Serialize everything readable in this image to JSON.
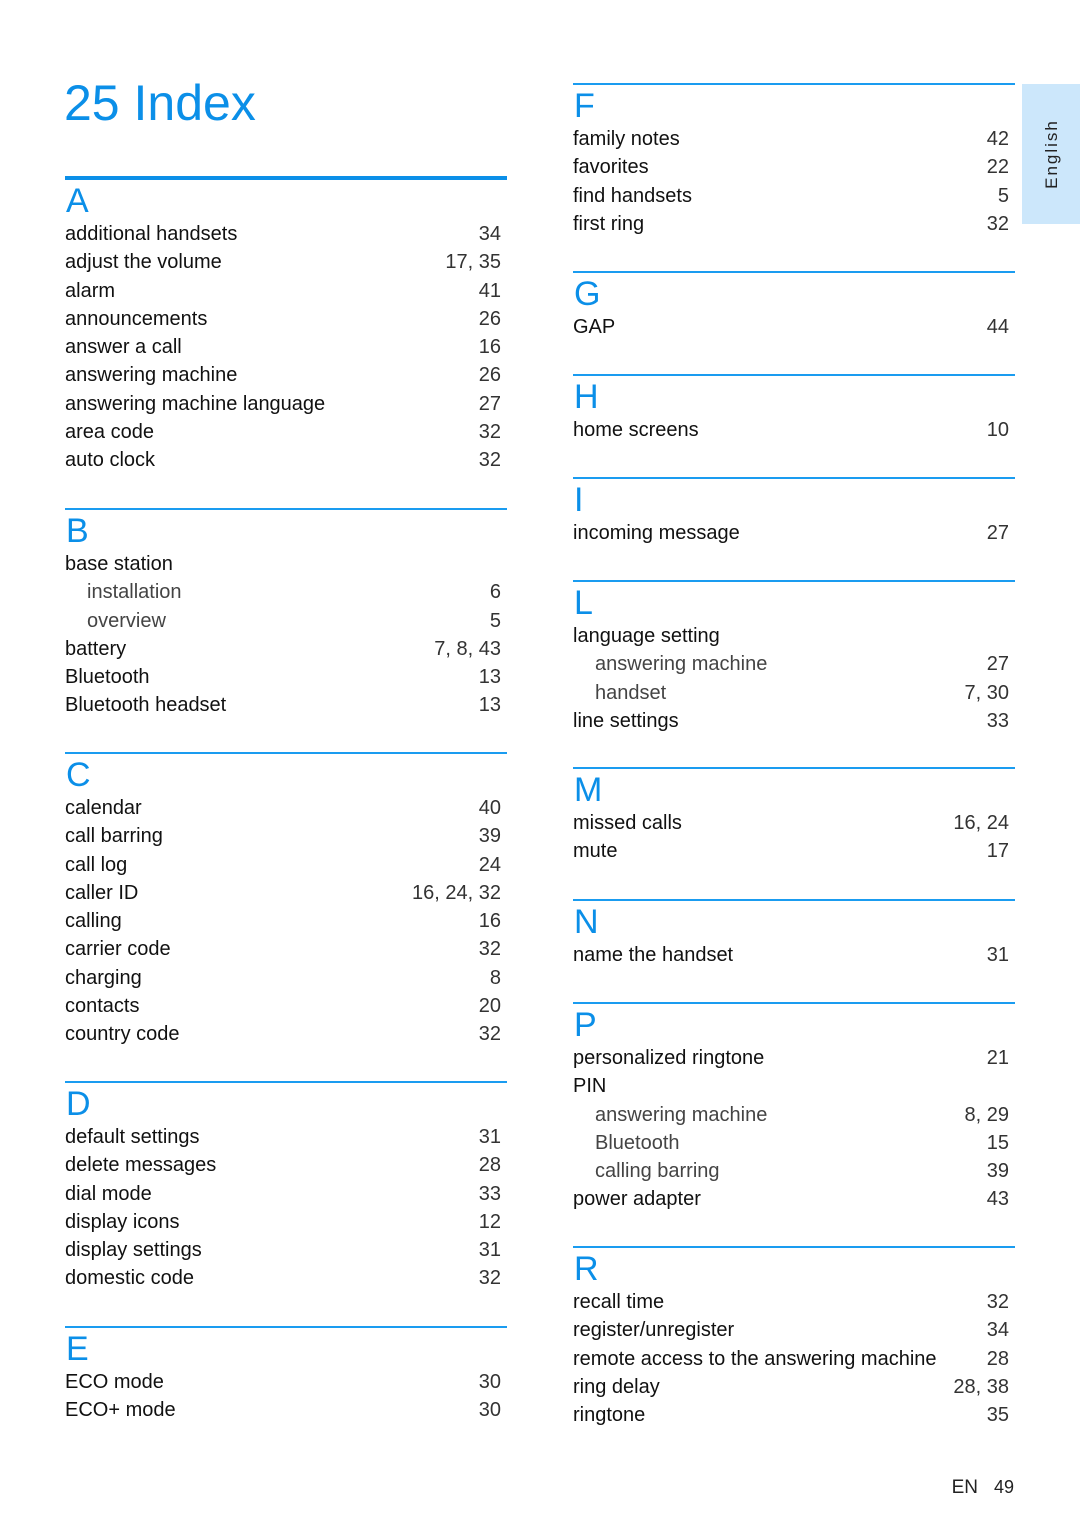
{
  "title": "25 Index",
  "language_tab": "English",
  "footer": {
    "lang": "EN",
    "page": "49"
  },
  "left": [
    {
      "letter": "A",
      "entries": [
        {
          "term": "additional handsets",
          "pages": "34"
        },
        {
          "term": "adjust the volume",
          "pages": "17, 35"
        },
        {
          "term": "alarm",
          "pages": "41"
        },
        {
          "term": "announcements",
          "pages": "26"
        },
        {
          "term": "answer a call",
          "pages": "16"
        },
        {
          "term": "answering machine",
          "pages": "26"
        },
        {
          "term": "answering machine language",
          "pages": "27"
        },
        {
          "term": "area code",
          "pages": "32"
        },
        {
          "term": "auto clock",
          "pages": "32"
        }
      ]
    },
    {
      "letter": "B",
      "entries": [
        {
          "term": "base station",
          "pages": ""
        },
        {
          "term": "installation",
          "pages": "6",
          "sub": true
        },
        {
          "term": "overview",
          "pages": "5",
          "sub": true
        },
        {
          "term": "battery",
          "pages": "7, 8, 43"
        },
        {
          "term": "Bluetooth",
          "pages": "13"
        },
        {
          "term": "Bluetooth headset",
          "pages": "13"
        }
      ]
    },
    {
      "letter": "C",
      "entries": [
        {
          "term": "calendar",
          "pages": "40"
        },
        {
          "term": "call barring",
          "pages": "39"
        },
        {
          "term": "call log",
          "pages": "24"
        },
        {
          "term": "caller ID",
          "pages": "16, 24, 32"
        },
        {
          "term": "calling",
          "pages": "16"
        },
        {
          "term": "carrier code",
          "pages": "32"
        },
        {
          "term": "charging",
          "pages": "8"
        },
        {
          "term": "contacts",
          "pages": "20"
        },
        {
          "term": "country code",
          "pages": "32"
        }
      ]
    },
    {
      "letter": "D",
      "entries": [
        {
          "term": "default settings",
          "pages": "31"
        },
        {
          "term": "delete messages",
          "pages": "28"
        },
        {
          "term": "dial mode",
          "pages": "33"
        },
        {
          "term": "display icons",
          "pages": "12"
        },
        {
          "term": "display settings",
          "pages": "31"
        },
        {
          "term": "domestic code",
          "pages": "32"
        }
      ]
    },
    {
      "letter": "E",
      "entries": [
        {
          "term": "ECO mode",
          "pages": "30"
        },
        {
          "term": "ECO+ mode",
          "pages": "30"
        }
      ]
    }
  ],
  "right": [
    {
      "letter": "F",
      "entries": [
        {
          "term": "family notes",
          "pages": "42"
        },
        {
          "term": "favorites",
          "pages": "22"
        },
        {
          "term": "find handsets",
          "pages": "5"
        },
        {
          "term": "first ring",
          "pages": "32"
        }
      ]
    },
    {
      "letter": "G",
      "entries": [
        {
          "term": "GAP",
          "pages": "44"
        }
      ]
    },
    {
      "letter": "H",
      "entries": [
        {
          "term": "home screens",
          "pages": "10"
        }
      ]
    },
    {
      "letter": "I",
      "entries": [
        {
          "term": "incoming message",
          "pages": "27"
        }
      ]
    },
    {
      "letter": "L",
      "entries": [
        {
          "term": "language setting",
          "pages": ""
        },
        {
          "term": "answering machine",
          "pages": "27",
          "sub": true
        },
        {
          "term": "handset",
          "pages": "7, 30",
          "sub": true
        },
        {
          "term": "line settings",
          "pages": "33"
        }
      ]
    },
    {
      "letter": "M",
      "entries": [
        {
          "term": "missed calls",
          "pages": "16, 24"
        },
        {
          "term": "mute",
          "pages": "17"
        }
      ]
    },
    {
      "letter": "N",
      "entries": [
        {
          "term": "name the handset",
          "pages": "31"
        }
      ]
    },
    {
      "letter": "P",
      "entries": [
        {
          "term": "personalized ringtone",
          "pages": "21"
        },
        {
          "term": "PIN",
          "pages": ""
        },
        {
          "term": "answering machine",
          "pages": "8, 29",
          "sub": true
        },
        {
          "term": "Bluetooth",
          "pages": "15",
          "sub": true
        },
        {
          "term": "calling barring",
          "pages": "39",
          "sub": true
        },
        {
          "term": "power adapter",
          "pages": "43"
        }
      ]
    },
    {
      "letter": "R",
      "entries": [
        {
          "term": "recall time",
          "pages": "32"
        },
        {
          "term": "register/unregister",
          "pages": "34"
        },
        {
          "term": "remote access to the answering machine",
          "pages": "28"
        },
        {
          "term": "ring delay",
          "pages": "28, 38"
        },
        {
          "term": "ringtone",
          "pages": "35"
        }
      ]
    }
  ]
}
